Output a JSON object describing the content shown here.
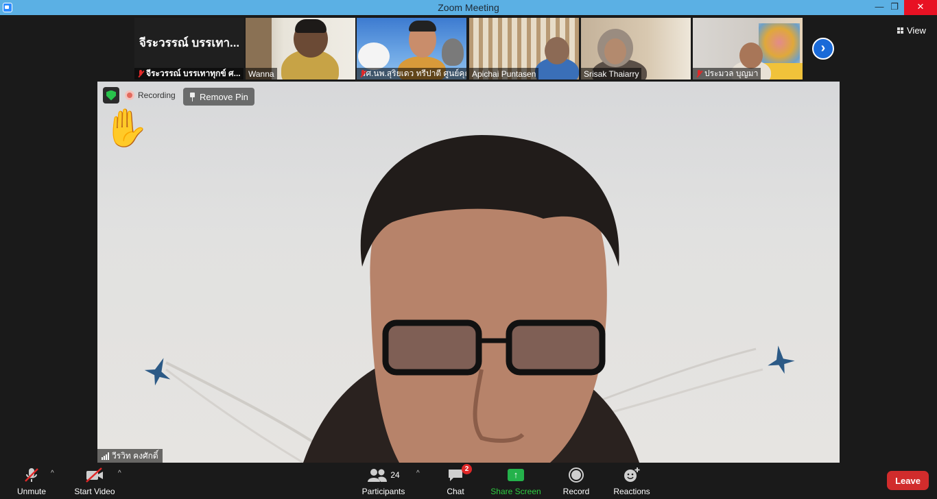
{
  "window": {
    "title": "Zoom Meeting",
    "min_glyph": "—",
    "max_glyph": "❐",
    "close_glyph": "✕"
  },
  "header": {
    "view_label": "View"
  },
  "thumbnails": [
    {
      "name": "จีระวรรณ์ บรรเทาทุกข์ ศ...",
      "tile_text": "จีระวรรณ์ บรรเทา...",
      "muted": true
    },
    {
      "name": "Wanna",
      "muted": false
    },
    {
      "name": "รศ.นพ.สุริยเดว ทรีปาตี ศูนย์คุณธ...",
      "muted": true
    },
    {
      "name": "Apichai Puntasen",
      "muted": false
    },
    {
      "name": "Srisak Thaiarry",
      "muted": false
    },
    {
      "name": "ประมวล บุญมา",
      "muted": true
    }
  ],
  "main": {
    "recording_label": "Recording",
    "remove_pin_label": "Remove Pin",
    "raised_hand_glyph": "✋",
    "speaker_name": "วีรวิท คงศักดิ์"
  },
  "toolbar": {
    "unmute": "Unmute",
    "start_video": "Start Video",
    "participants": "Participants",
    "participants_count": "24",
    "chat": "Chat",
    "chat_badge": "2",
    "share_screen": "Share Screen",
    "share_glyph": "↑",
    "record": "Record",
    "reactions": "Reactions",
    "leave": "Leave",
    "caret": "^"
  },
  "colors": {
    "titlebar": "#5bb0e4",
    "leave": "#d12c2c",
    "share_green": "#2ecc40",
    "muted_red": "#e02828"
  }
}
